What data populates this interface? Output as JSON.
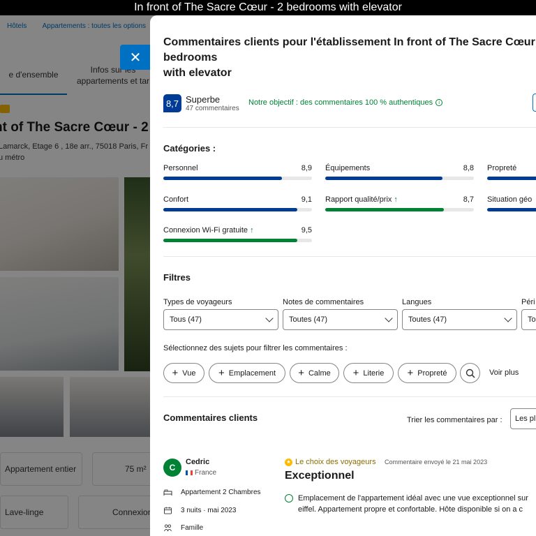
{
  "caption": "In front of The Sacre Cœur - 2 bedrooms with elevator",
  "background": {
    "breadcrumbs": [
      "Hôtels",
      "Appartements : toutes les options"
    ],
    "tabs": [
      {
        "label": "e d'ensemble",
        "active": true
      },
      {
        "label": "Infos sur les\nappartements et tar",
        "active": false
      }
    ],
    "hotel_title": "nt of The Sacre Cœur - 2",
    "address": "Lamarck, Etage 6 , 18e arr., 75018 Paris, Fr",
    "metro": "u métro",
    "features": [
      {
        "label": "Appartement entier"
      },
      {
        "label": "75 m²"
      },
      {
        "label": "Lave-linge"
      },
      {
        "label": "Connexion"
      }
    ],
    "close_symbol": "✕"
  },
  "panel": {
    "title": "Commentaires clients pour l'établissement In front of The Sacre Cœur - 2 bedrooms\nwith elevator",
    "score": "8,7",
    "score_word": "Superbe",
    "score_count": "47 commentaires",
    "objective": "Notre objectif : des commentaires 100 % authentiques",
    "categories_heading": "Catégories :",
    "categories": [
      {
        "label": "Personnel",
        "score": "8,9",
        "fill": 0.8,
        "color": "#003b95",
        "arrow": false
      },
      {
        "label": "Équipements",
        "score": "8,8",
        "fill": 0.79,
        "color": "#003b95",
        "arrow": false
      },
      {
        "label": "Propreté",
        "score": "",
        "fill": 1,
        "color": "#003b95",
        "arrow": false
      },
      {
        "label": "Confort",
        "score": "9,1",
        "fill": 0.9,
        "color": "#003b95",
        "arrow": false
      },
      {
        "label": "Rapport qualité/prix",
        "score": "8,7",
        "fill": 0.8,
        "color": "#008234",
        "arrow": true
      },
      {
        "label": "Situation géo",
        "score": "",
        "fill": 1,
        "color": "#003b95",
        "arrow": false
      },
      {
        "label": "Connexion Wi-Fi gratuite",
        "score": "9,5",
        "fill": 0.9,
        "color": "#008234",
        "arrow": true
      }
    ],
    "filters_heading": "Filtres",
    "filters": [
      {
        "label": "Types de voyageurs",
        "value": "Tous (47)"
      },
      {
        "label": "Notes de commentaires",
        "value": "Toutes (47)"
      },
      {
        "label": "Langues",
        "value": "Toutes (47)"
      },
      {
        "label": "Péri",
        "value": "To"
      }
    ],
    "subjects_hint": "Sélectionnez des sujets pour filtrer les commentaires :",
    "subjects": [
      "Vue",
      "Emplacement",
      "Calme",
      "Literie",
      "Propreté"
    ],
    "see_more": "Voir plus",
    "reviews_heading": "Commentaires clients",
    "sort_label": "Trier les commentaires par :",
    "sort_value": "Les pl",
    "review": {
      "initial": "C",
      "name": "Cedric",
      "country": "France",
      "room": "Appartement 2 Chambres",
      "stay": "3 nuits · mai 2023",
      "traveler": "Famille",
      "badge": "Le choix des voyageurs",
      "posted": "Commentaire envoyé le 21 mai 2023",
      "title": "Exceptionnel",
      "text": "Emplacement de l'appartement idéal avec une vue exceptionnel sur\neiffel. Appartement propre et confortable. Hôte disponible si on a c"
    }
  }
}
